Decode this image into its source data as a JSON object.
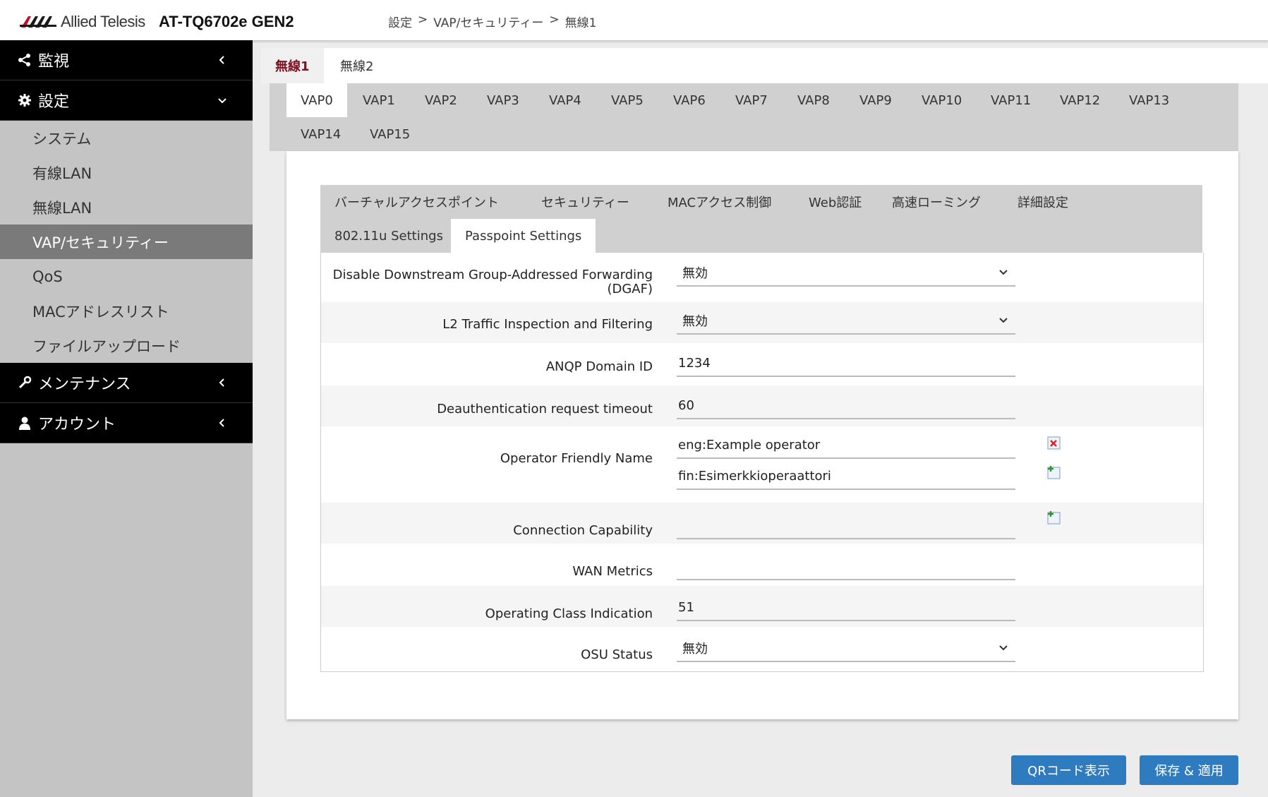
{
  "header": {
    "brand": "Allied Telesis",
    "model": "AT-TQ6702e GEN2",
    "breadcrumb": [
      "設定",
      ">",
      "VAP/セキュリティー",
      ">",
      "無線1"
    ]
  },
  "sidebar": {
    "monitor": "監視",
    "settings": "設定",
    "items": [
      "システム",
      "有線LAN",
      "無線LAN",
      "VAP/セキュリティー",
      "QoS",
      "MACアドレスリスト",
      "ファイルアップロード"
    ],
    "active_item": "VAP/セキュリティー",
    "maintenance": "メンテナンス",
    "account": "アカウント"
  },
  "radio_tabs": [
    "無線1",
    "無線2"
  ],
  "vap_tabs": [
    "VAP0",
    "VAP1",
    "VAP2",
    "VAP3",
    "VAP4",
    "VAP5",
    "VAP6",
    "VAP7",
    "VAP8",
    "VAP9",
    "VAP10",
    "VAP11",
    "VAP12",
    "VAP13",
    "VAP14",
    "VAP15"
  ],
  "sub_tabs": [
    "バーチャルアクセスポイント",
    "セキュリティー",
    "MACアクセス制御",
    "Web認証",
    "高速ローミング",
    "詳細設定",
    "802.11u Settings",
    "Passpoint Settings"
  ],
  "form": {
    "dgaf_label_1": "Disable Downstream Group-Addressed Forwarding",
    "dgaf_label_2": "(DGAF)",
    "dgaf_value": "無効",
    "l2_label": "L2 Traffic Inspection and Filtering",
    "l2_value": "無効",
    "anqp_label": "ANQP Domain ID",
    "anqp_value": "1234",
    "deauth_label": "Deauthentication request timeout",
    "deauth_value": "60",
    "ofn_label": "Operator Friendly Name",
    "ofn_value_1": "eng:Example operator",
    "ofn_value_2": "fin:Esimerkkioperaattori",
    "conncap_label": "Connection Capability",
    "conncap_value": "",
    "wan_label": "WAN Metrics",
    "wan_value": "",
    "oci_label": "Operating Class Indication",
    "oci_value": "51",
    "osu_label": "OSU Status",
    "osu_value": "無効"
  },
  "buttons": {
    "qr": "QRコード表示",
    "save": "保存 & 適用"
  },
  "colors": {
    "accent_blue": "#2f7bbf",
    "active_radio_tab": "#7a1020",
    "brand_red": "#c8102e"
  }
}
